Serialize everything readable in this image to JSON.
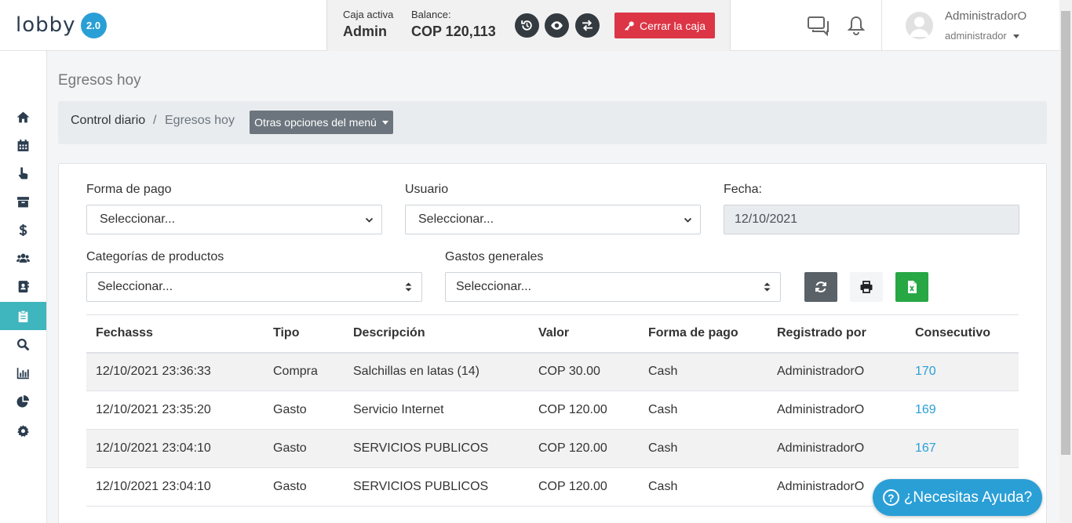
{
  "app": {
    "logo_text": "lobby",
    "version": "2.0"
  },
  "cashbox": {
    "active_label": "Caja activa",
    "active_value": "Admin",
    "balance_label": "Balance:",
    "balance_value": "COP 120,113",
    "close_label": "Cerrar la caja"
  },
  "user": {
    "name": "AdministradorO",
    "role": "administrador"
  },
  "page": {
    "title": "Egresos hoy",
    "breadcrumb": [
      "Control diario",
      "/",
      "Egresos hoy"
    ],
    "menu_button": "Otras opciones del menú"
  },
  "filters": {
    "payment_label": "Forma de pago",
    "payment_value": "Seleccionar...",
    "user_label": "Usuario",
    "user_value": "Seleccionar...",
    "date_label": "Fecha:",
    "date_value": "12/10/2021",
    "categories_label": "Categorías de productos",
    "categories_value": "Seleccionar...",
    "expenses_label": "Gastos generales",
    "expenses_value": "Seleccionar..."
  },
  "table": {
    "columns": [
      "Fechasss",
      "Tipo",
      "Descripción",
      "Valor",
      "Forma de pago",
      "Registrado por",
      "Consecutivo"
    ],
    "rows": [
      [
        "12/10/2021 23:36:33",
        "Compra",
        "Salchillas en latas (14)",
        "COP 30.00",
        "Cash",
        "AdministradorO",
        "170"
      ],
      [
        "12/10/2021 23:35:20",
        "Gasto",
        "Servicio Internet",
        "COP 120.00",
        "Cash",
        "AdministradorO",
        "169"
      ],
      [
        "12/10/2021 23:04:10",
        "Gasto",
        "SERVICIOS PUBLICOS",
        "COP 120.00",
        "Cash",
        "AdministradorO",
        "167"
      ],
      [
        "12/10/2021 23:04:10",
        "Gasto",
        "SERVICIOS PUBLICOS",
        "COP 120.00",
        "Cash",
        "AdministradorO",
        ""
      ]
    ]
  },
  "help": {
    "label": "¿Necesitas Ayuda?"
  },
  "colors": {
    "accent": "#2a9fd6",
    "danger": "#dc3545",
    "sidebar_active": "#3fb5be",
    "excel": "#28a745"
  }
}
